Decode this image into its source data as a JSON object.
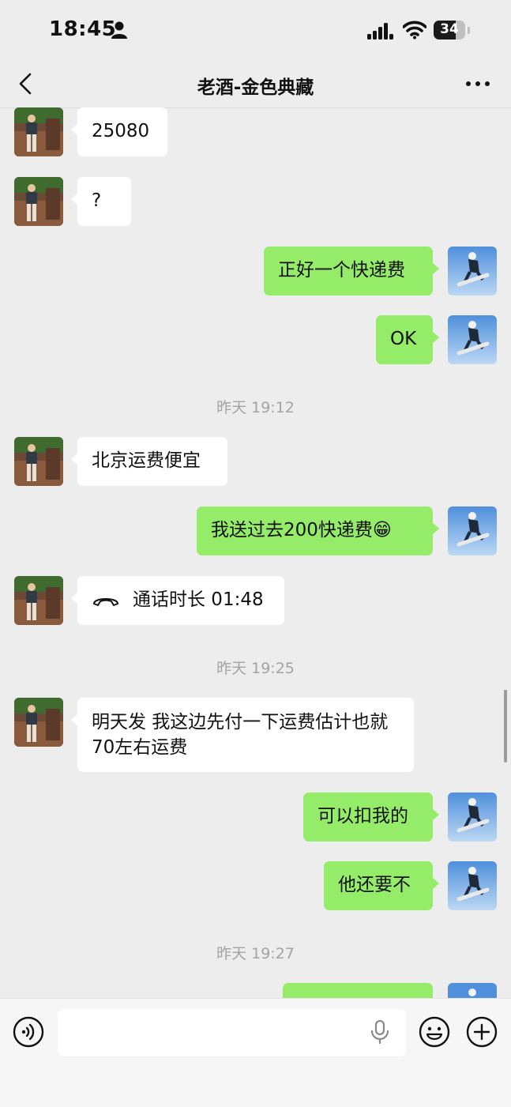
{
  "status_bar": {
    "time": "18:45",
    "battery": "34"
  },
  "header": {
    "title": "老酒-金色典藏"
  },
  "messages": [
    {
      "text": "25080"
    },
    {
      "text": "?"
    },
    {
      "text": "正好一个快递费"
    },
    {
      "text": "OK"
    },
    {
      "timestamp": "昨天 19:12"
    },
    {
      "text": "北京运费便宜"
    },
    {
      "text": "我送过去200快递费😁"
    },
    {
      "text": "通话时长 01:48",
      "icon": "phone-call-icon"
    },
    {
      "timestamp": "昨天 19:25"
    },
    {
      "text": "明天发 我这边先付一下运费估计也就70左右运费"
    },
    {
      "text": "可以扣我的"
    },
    {
      "text": "他还要不"
    },
    {
      "timestamp": "昨天 19:27"
    }
  ],
  "icons": {
    "back": "chevron-left-icon",
    "more": "more-dots-icon",
    "voice": "voice-input-icon",
    "mic": "microphone-icon",
    "emoji": "emoji-icon",
    "plus": "plus-icon"
  },
  "colors": {
    "background": "#ededed",
    "outgoing_bubble": "#95ec69",
    "incoming_bubble": "#ffffff",
    "timestamp": "#a3a3a3"
  }
}
